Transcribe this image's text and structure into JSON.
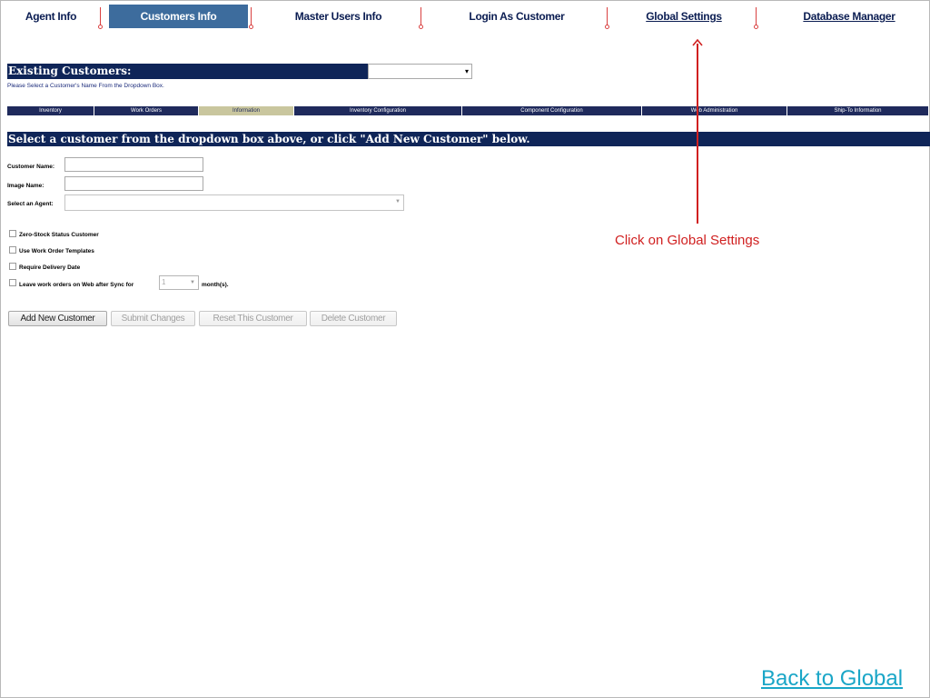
{
  "nav": {
    "items": [
      {
        "label": "Agent Info"
      },
      {
        "label": "Customers Info"
      },
      {
        "label": "Master Users Info"
      },
      {
        "label": "Login As Customer"
      },
      {
        "label": "Global Settings"
      },
      {
        "label": "Database Manager"
      }
    ],
    "active_index": 1
  },
  "existing": {
    "title": "Existing Customers:",
    "hint": "Please Select a Customer's Name From the Dropdown Box.",
    "selected": ""
  },
  "tabs": [
    {
      "label": "Inventory"
    },
    {
      "label": "Work Orders"
    },
    {
      "label": "Information"
    },
    {
      "label": "Inventory Configuration"
    },
    {
      "label": "Component Configuration"
    },
    {
      "label": "Web Administration"
    },
    {
      "label": "Ship-To Information"
    }
  ],
  "active_tab_index": 2,
  "select_message": "Select a customer from the dropdown box above, or click \"Add New Customer\" below.",
  "form": {
    "customer_name_label": "Customer Name:",
    "customer_name_value": "",
    "image_name_label": "Image Name:",
    "image_name_value": "",
    "agent_label": "Select an Agent:",
    "agent_value": ""
  },
  "options": {
    "zero_stock": "Zero-Stock Status Customer",
    "work_order_templates": "Use Work Order Templates",
    "require_delivery": "Require Delivery Date",
    "leave_orders": "Leave work orders on Web after Sync for",
    "months_value": "1",
    "months_suffix": "month(s)."
  },
  "buttons": {
    "add": "Add New Customer",
    "submit": "Submit Changes",
    "reset": "Reset This Customer",
    "delete": "Delete Customer"
  },
  "annotation": {
    "text": "Click on Global Settings",
    "color": "#d02020"
  },
  "back_link": "Back to Global",
  "colors": {
    "navy": "#0f2558",
    "active_nav": "#3d6c9d",
    "active_tab": "#c9c69e",
    "link": "#1aa6c7"
  }
}
